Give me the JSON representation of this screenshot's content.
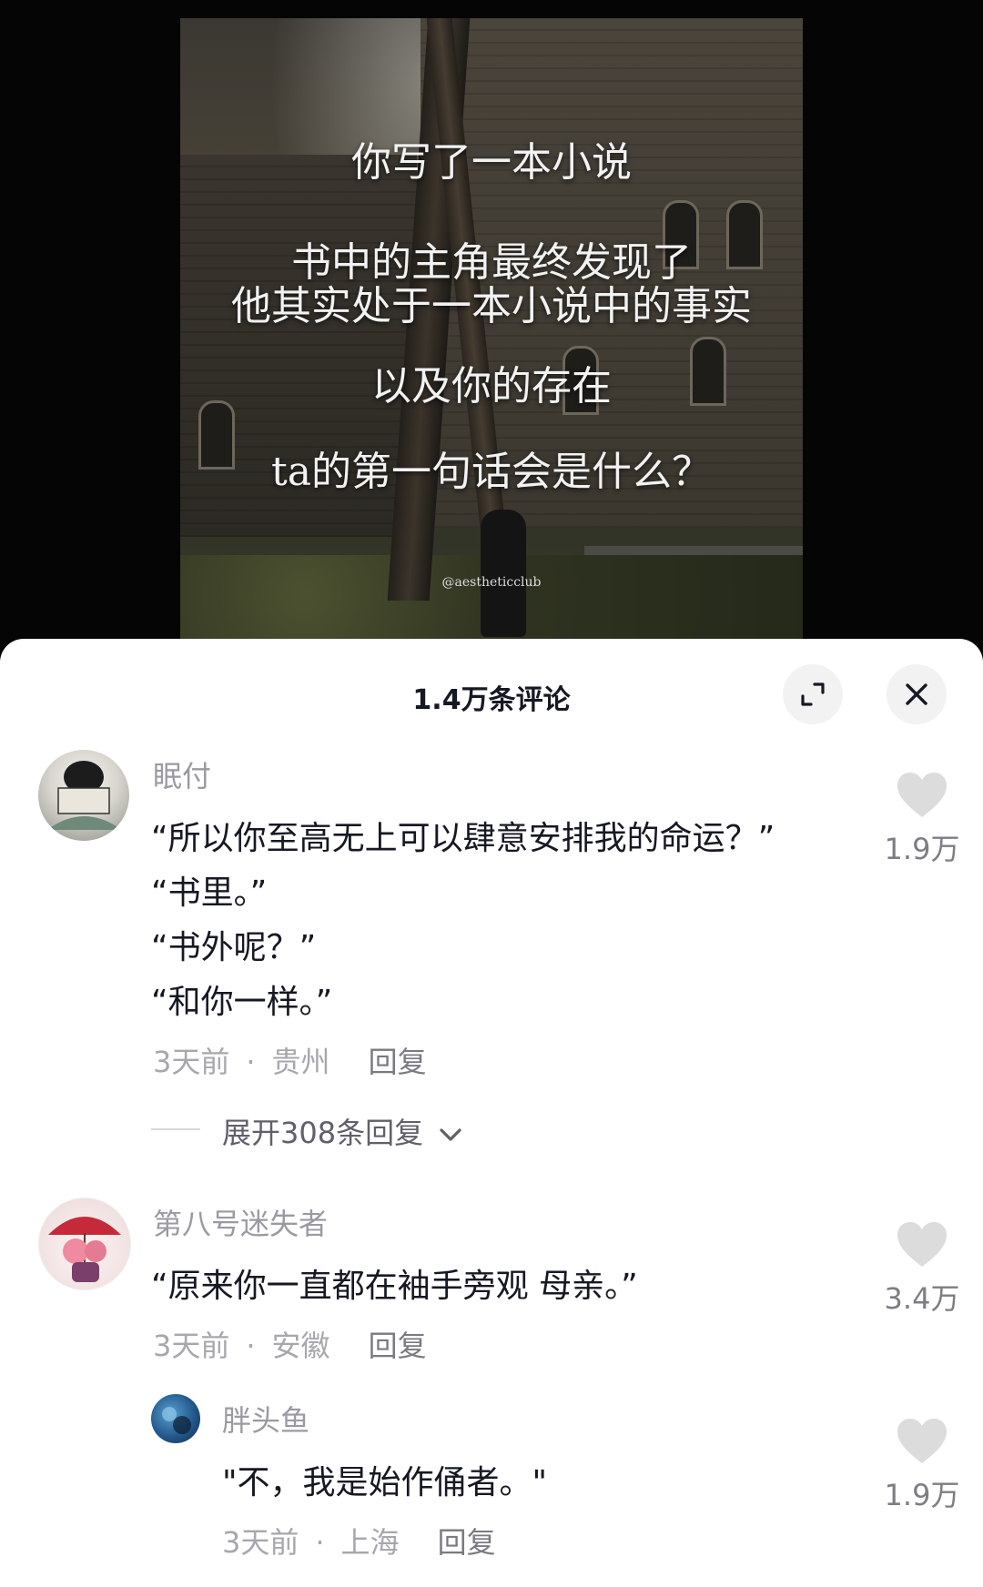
{
  "video": {
    "lines": [
      "你写了一本小说",
      "书中的主角最终发现了",
      "他其实处于一本小说中的事实",
      "以及你的存在",
      "ta的第一句话会是什么？"
    ],
    "watermark": "@aestheticclub"
  },
  "sheet": {
    "title": "1.4万条评论",
    "expand_icon": "expand-icon",
    "close_icon": "close-icon"
  },
  "comments": [
    {
      "username": "眠付",
      "lines": [
        "“所以你至高无上可以肆意安排我的命运？”",
        "“书里。”",
        "“书外呢？”",
        "“和你一样。”"
      ],
      "time": "3天前",
      "location": "贵州",
      "reply_label": "回复",
      "likes": "1.9万",
      "expand_replies": "展开308条回复"
    },
    {
      "username": "第八号迷失者",
      "lines": [
        "“原来你一直都在袖手旁观 母亲。”"
      ],
      "time": "3天前",
      "location": "安徽",
      "reply_label": "回复",
      "likes": "3.4万"
    }
  ],
  "sub_reply": {
    "username": "胖头鱼",
    "text": "\"不，我是始作俑者。\"",
    "time": "3天前",
    "location": "上海",
    "reply_label": "回复",
    "likes": "1.9万"
  },
  "colors": {
    "text": "#161823",
    "muted": "#9a9aa2",
    "heart": "#dcdcdc"
  }
}
